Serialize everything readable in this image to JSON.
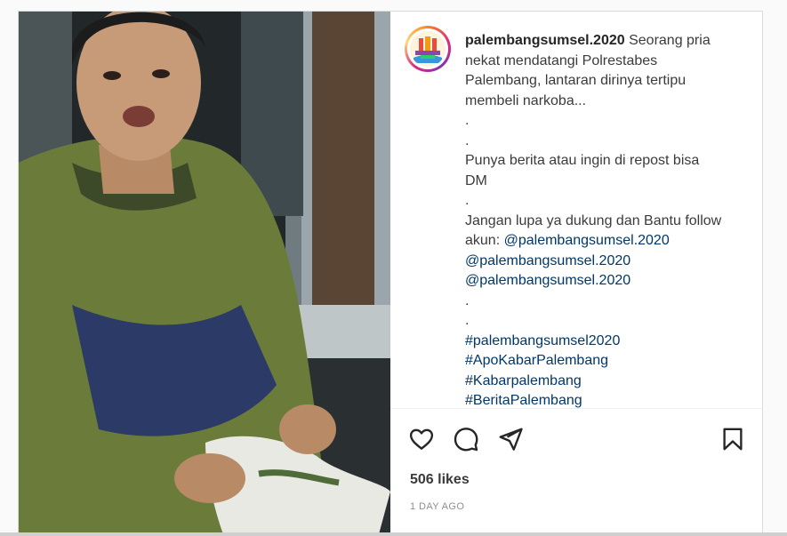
{
  "post": {
    "username": "palembangsumsel.2020",
    "avatar_icon": "palembang-logo",
    "caption_lines": [
      "Seorang pria",
      "nekat mendatangi Polrestabes",
      "Palembang, lantaran dirinya tertipu",
      "membeli narkoba...",
      ".",
      ".",
      "Punya berita atau ingin di repost bisa",
      "DM",
      ".",
      "Jangan lupa ya dukung dan Bantu follow",
      "akun:"
    ],
    "mention_inline": "@palembangsumsel.2020",
    "mentions": [
      "@palembangsumsel.2020",
      "@palembangsumsel.2020"
    ],
    "dots_after_mentions": [
      ".",
      "."
    ],
    "hashtags": [
      "#palembangsumsel2020",
      "#ApoKabarPalembang",
      "#Kabarpalembang",
      "#BeritaPalembang"
    ],
    "likes_text": "506 likes",
    "timestamp": "1 DAY AGO",
    "actions": {
      "like_icon": "heart-icon",
      "comment_icon": "comment-icon",
      "share_icon": "send-icon",
      "save_icon": "bookmark-icon"
    }
  },
  "colors": {
    "text": "#262626",
    "link": "#00376b",
    "muted": "#8e8e8e",
    "border": "#dbdbdb"
  }
}
